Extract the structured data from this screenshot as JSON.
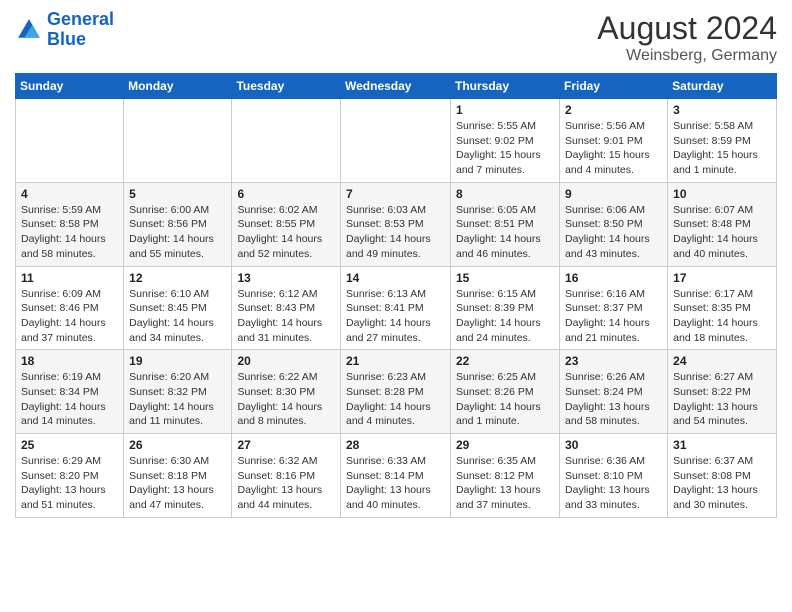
{
  "header": {
    "logo_line1": "General",
    "logo_line2": "Blue",
    "month": "August 2024",
    "location": "Weinsberg, Germany"
  },
  "weekdays": [
    "Sunday",
    "Monday",
    "Tuesday",
    "Wednesday",
    "Thursday",
    "Friday",
    "Saturday"
  ],
  "weeks": [
    [
      {
        "day": "",
        "info": ""
      },
      {
        "day": "",
        "info": ""
      },
      {
        "day": "",
        "info": ""
      },
      {
        "day": "",
        "info": ""
      },
      {
        "day": "1",
        "info": "Sunrise: 5:55 AM\nSunset: 9:02 PM\nDaylight: 15 hours and 7 minutes."
      },
      {
        "day": "2",
        "info": "Sunrise: 5:56 AM\nSunset: 9:01 PM\nDaylight: 15 hours and 4 minutes."
      },
      {
        "day": "3",
        "info": "Sunrise: 5:58 AM\nSunset: 8:59 PM\nDaylight: 15 hours and 1 minute."
      }
    ],
    [
      {
        "day": "4",
        "info": "Sunrise: 5:59 AM\nSunset: 8:58 PM\nDaylight: 14 hours and 58 minutes."
      },
      {
        "day": "5",
        "info": "Sunrise: 6:00 AM\nSunset: 8:56 PM\nDaylight: 14 hours and 55 minutes."
      },
      {
        "day": "6",
        "info": "Sunrise: 6:02 AM\nSunset: 8:55 PM\nDaylight: 14 hours and 52 minutes."
      },
      {
        "day": "7",
        "info": "Sunrise: 6:03 AM\nSunset: 8:53 PM\nDaylight: 14 hours and 49 minutes."
      },
      {
        "day": "8",
        "info": "Sunrise: 6:05 AM\nSunset: 8:51 PM\nDaylight: 14 hours and 46 minutes."
      },
      {
        "day": "9",
        "info": "Sunrise: 6:06 AM\nSunset: 8:50 PM\nDaylight: 14 hours and 43 minutes."
      },
      {
        "day": "10",
        "info": "Sunrise: 6:07 AM\nSunset: 8:48 PM\nDaylight: 14 hours and 40 minutes."
      }
    ],
    [
      {
        "day": "11",
        "info": "Sunrise: 6:09 AM\nSunset: 8:46 PM\nDaylight: 14 hours and 37 minutes."
      },
      {
        "day": "12",
        "info": "Sunrise: 6:10 AM\nSunset: 8:45 PM\nDaylight: 14 hours and 34 minutes."
      },
      {
        "day": "13",
        "info": "Sunrise: 6:12 AM\nSunset: 8:43 PM\nDaylight: 14 hours and 31 minutes."
      },
      {
        "day": "14",
        "info": "Sunrise: 6:13 AM\nSunset: 8:41 PM\nDaylight: 14 hours and 27 minutes."
      },
      {
        "day": "15",
        "info": "Sunrise: 6:15 AM\nSunset: 8:39 PM\nDaylight: 14 hours and 24 minutes."
      },
      {
        "day": "16",
        "info": "Sunrise: 6:16 AM\nSunset: 8:37 PM\nDaylight: 14 hours and 21 minutes."
      },
      {
        "day": "17",
        "info": "Sunrise: 6:17 AM\nSunset: 8:35 PM\nDaylight: 14 hours and 18 minutes."
      }
    ],
    [
      {
        "day": "18",
        "info": "Sunrise: 6:19 AM\nSunset: 8:34 PM\nDaylight: 14 hours and 14 minutes."
      },
      {
        "day": "19",
        "info": "Sunrise: 6:20 AM\nSunset: 8:32 PM\nDaylight: 14 hours and 11 minutes."
      },
      {
        "day": "20",
        "info": "Sunrise: 6:22 AM\nSunset: 8:30 PM\nDaylight: 14 hours and 8 minutes."
      },
      {
        "day": "21",
        "info": "Sunrise: 6:23 AM\nSunset: 8:28 PM\nDaylight: 14 hours and 4 minutes."
      },
      {
        "day": "22",
        "info": "Sunrise: 6:25 AM\nSunset: 8:26 PM\nDaylight: 14 hours and 1 minute."
      },
      {
        "day": "23",
        "info": "Sunrise: 6:26 AM\nSunset: 8:24 PM\nDaylight: 13 hours and 58 minutes."
      },
      {
        "day": "24",
        "info": "Sunrise: 6:27 AM\nSunset: 8:22 PM\nDaylight: 13 hours and 54 minutes."
      }
    ],
    [
      {
        "day": "25",
        "info": "Sunrise: 6:29 AM\nSunset: 8:20 PM\nDaylight: 13 hours and 51 minutes."
      },
      {
        "day": "26",
        "info": "Sunrise: 6:30 AM\nSunset: 8:18 PM\nDaylight: 13 hours and 47 minutes."
      },
      {
        "day": "27",
        "info": "Sunrise: 6:32 AM\nSunset: 8:16 PM\nDaylight: 13 hours and 44 minutes."
      },
      {
        "day": "28",
        "info": "Sunrise: 6:33 AM\nSunset: 8:14 PM\nDaylight: 13 hours and 40 minutes."
      },
      {
        "day": "29",
        "info": "Sunrise: 6:35 AM\nSunset: 8:12 PM\nDaylight: 13 hours and 37 minutes."
      },
      {
        "day": "30",
        "info": "Sunrise: 6:36 AM\nSunset: 8:10 PM\nDaylight: 13 hours and 33 minutes."
      },
      {
        "day": "31",
        "info": "Sunrise: 6:37 AM\nSunset: 8:08 PM\nDaylight: 13 hours and 30 minutes."
      }
    ]
  ]
}
